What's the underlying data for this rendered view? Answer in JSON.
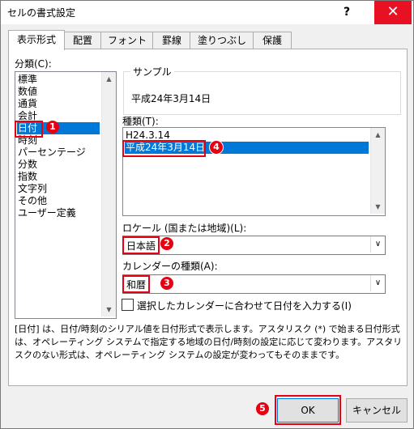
{
  "window": {
    "title": "セルの書式設定",
    "help": "?",
    "close": "✕"
  },
  "tabs": [
    "表示形式",
    "配置",
    "フォント",
    "罫線",
    "塗りつぶし",
    "保護"
  ],
  "category": {
    "label": "分類(C):",
    "items": [
      "標準",
      "数値",
      "通貨",
      "会計",
      "日付",
      "時刻",
      "パーセンテージ",
      "分数",
      "指数",
      "文字列",
      "その他",
      "ユーザー定義"
    ],
    "selected": "日付"
  },
  "sample": {
    "label": "サンプル",
    "value": "平成24年3月14日"
  },
  "types": {
    "label": "種類(T):",
    "items": [
      "H24.3.14",
      "平成24年3月14日"
    ],
    "selected": "平成24年3月14日"
  },
  "locale": {
    "label": "ロケール (国または地域)(L):",
    "value": "日本語"
  },
  "calendar": {
    "label": "カレンダーの種類(A):",
    "value": "和暦"
  },
  "checkbox": {
    "label": "選択したカレンダーに合わせて日付を入力する(I)",
    "checked": false
  },
  "description": "[日付] は、日付/時刻のシリアル値を日付形式で表示します。アスタリスク (*) で始まる日付形式は、オペレーティング システムで指定する地域の日付/時刻の設定に応じて変わります。アスタリスクのない形式は、オペレーティング システムの設定が変わってもそのままです。",
  "buttons": {
    "ok": "OK",
    "cancel": "キャンセル"
  },
  "markers": [
    "1",
    "2",
    "3",
    "4",
    "5"
  ],
  "colors": {
    "accent": "#0078d7",
    "annotation": "#e60012",
    "close": "#e81123"
  }
}
